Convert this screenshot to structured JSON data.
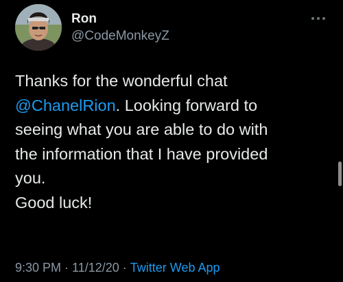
{
  "author": {
    "name": "Ron",
    "handle": "@CodeMonkeyZ",
    "avatar_icon": "profile-photo"
  },
  "more_icon": "more-dots-icon",
  "tweet": {
    "line1": "Thanks for the wonderful chat",
    "mention": "@ChanelRion",
    "line2_rest": ". Looking forward to",
    "line3": "seeing what you are able to do with",
    "line4": "the information that I have provided",
    "line5": "you.",
    "line6": "Good luck!"
  },
  "meta": {
    "time": "9:30 PM",
    "separator": "·",
    "date": "11/12/20",
    "source": "Twitter Web App"
  },
  "colors": {
    "background": "#000000",
    "text": "#e7e9ea",
    "secondary": "#8b98a5",
    "link": "#1d9bf0"
  }
}
